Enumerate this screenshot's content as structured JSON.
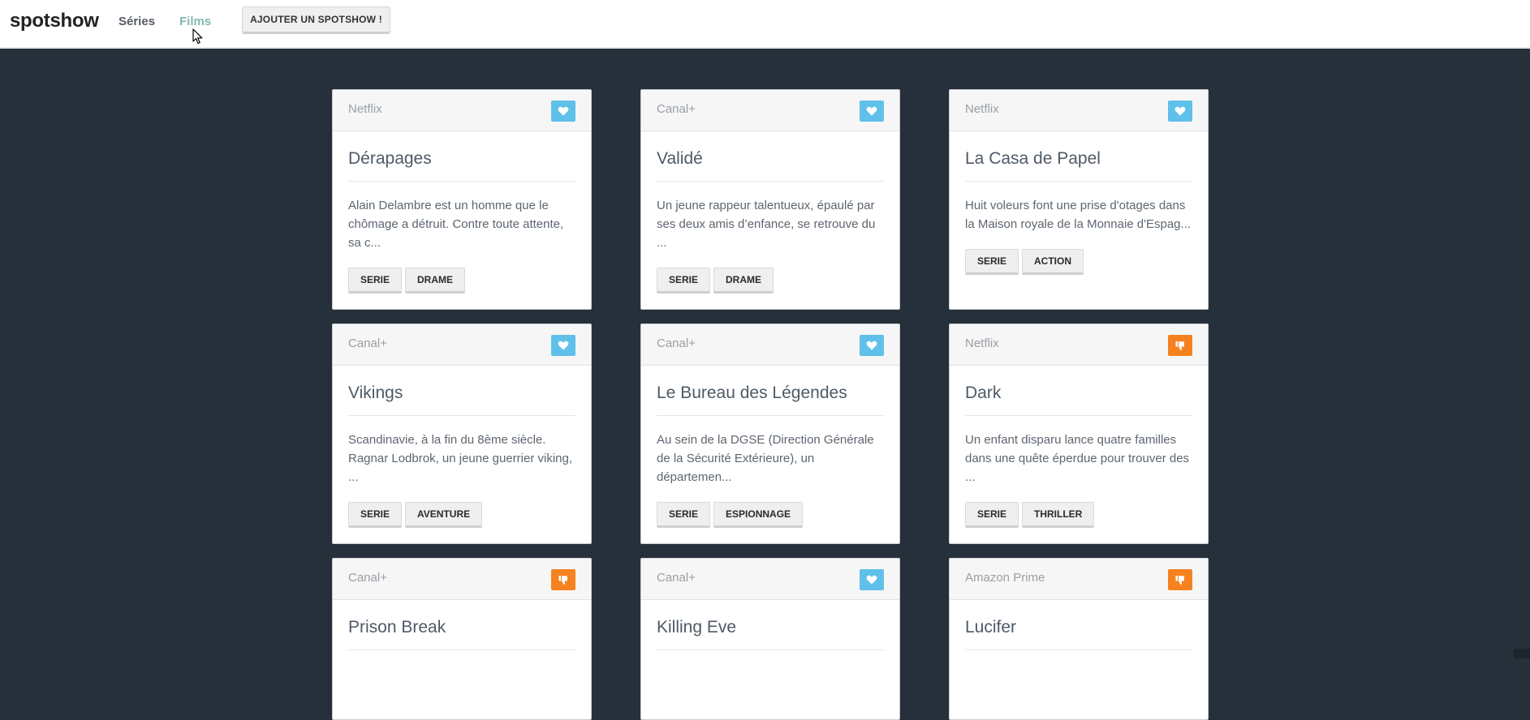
{
  "navbar": {
    "brand": "spotshow",
    "links": {
      "series": "Séries",
      "films": "Films"
    },
    "add_button": "AJOUTER UN SPOTSHOW !"
  },
  "colors": {
    "page_background": "#25303a",
    "like": "#5fc0ea",
    "dislike": "#f5821f",
    "films_link": "#84b8b0"
  },
  "cards": [
    {
      "provider": "Netflix",
      "status": "like",
      "status_icon": "heart-icon",
      "title": "Dérapages",
      "description": "Alain Delambre est un homme que le chômage a détruit. Contre toute attente, sa c...",
      "tags": [
        "SERIE",
        "DRAME"
      ]
    },
    {
      "provider": "Canal+",
      "status": "like",
      "status_icon": "heart-icon",
      "title": "Validé",
      "description": "Un jeune rappeur talentueux, épaulé par ses deux amis d’enfance, se retrouve du ...",
      "tags": [
        "SERIE",
        "DRAME"
      ]
    },
    {
      "provider": "Netflix",
      "status": "like",
      "status_icon": "heart-icon",
      "title": "La Casa de Papel",
      "description": "Huit voleurs font une prise d'otages dans la Maison royale de la Monnaie d'Espag...",
      "tags": [
        "SERIE",
        "ACTION"
      ]
    },
    {
      "provider": "Canal+",
      "status": "like",
      "status_icon": "heart-icon",
      "title": "Vikings",
      "description": "Scandinavie, à la fin du 8ème siècle. Ragnar Lodbrok, un jeune guerrier viking, ...",
      "tags": [
        "SERIE",
        "AVENTURE"
      ]
    },
    {
      "provider": "Canal+",
      "status": "like",
      "status_icon": "heart-icon",
      "title": "Le Bureau des Légendes",
      "description": "Au sein de la DGSE (Direction Générale de la Sécurité Extérieure), un départemen...",
      "tags": [
        "SERIE",
        "ESPIONNAGE"
      ]
    },
    {
      "provider": "Netflix",
      "status": "dislike",
      "status_icon": "thumbs-down-icon",
      "title": "Dark",
      "description": "Un enfant disparu lance quatre familles dans une quête éperdue pour trouver des ...",
      "tags": [
        "SERIE",
        "THRILLER"
      ]
    },
    {
      "provider": "Canal+",
      "status": "dislike",
      "status_icon": "thumbs-down-icon",
      "title": "Prison Break",
      "description": "",
      "tags": []
    },
    {
      "provider": "Canal+",
      "status": "like",
      "status_icon": "heart-icon",
      "title": "Killing Eve",
      "description": "",
      "tags": []
    },
    {
      "provider": "Amazon Prime",
      "status": "dislike",
      "status_icon": "thumbs-down-icon",
      "title": "Lucifer",
      "description": "",
      "tags": []
    }
  ]
}
